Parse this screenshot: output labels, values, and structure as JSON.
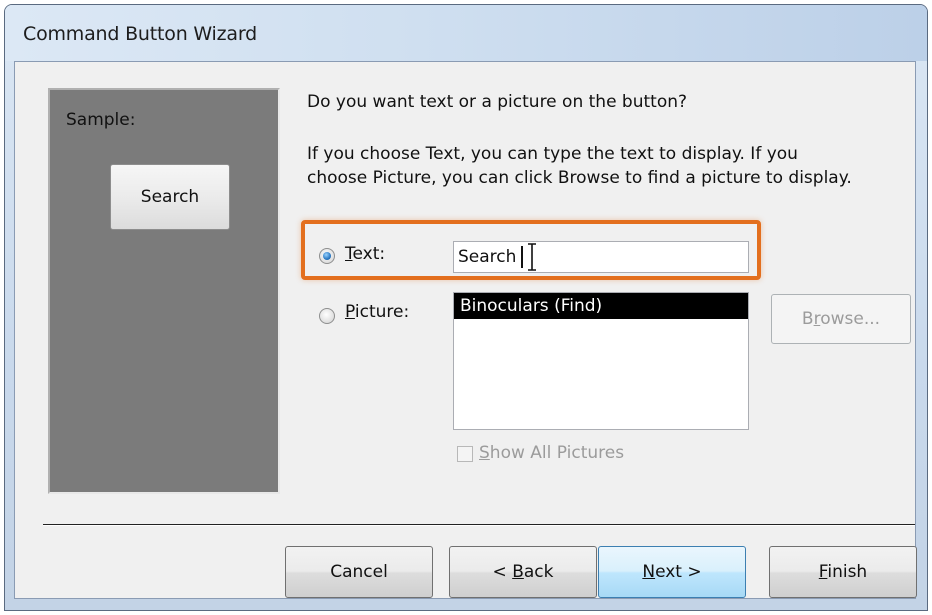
{
  "window": {
    "title": "Command Button Wizard"
  },
  "sample": {
    "label": "Sample:",
    "button_label": "Search"
  },
  "prompt": {
    "question": "Do you want text or a picture on the button?",
    "help_line1": "If you choose Text, you can type the text to display.  If you",
    "help_line2": "choose Picture, you can click Browse to find a picture to display."
  },
  "options": {
    "text_label": "Text:",
    "text_value": "Search",
    "text_selected": true,
    "picture_label": "Picture:",
    "picture_selected": false
  },
  "picture_list": {
    "items": [
      "Binoculars (Find)"
    ],
    "selected_index": 0
  },
  "browse_button": {
    "label": "Browse...",
    "enabled": false
  },
  "show_all_pictures": {
    "label": "Show All Pictures",
    "checked": false,
    "enabled": false
  },
  "footer": {
    "cancel": "Cancel",
    "back": "< Back",
    "next": "Next >",
    "finish": "Finish"
  },
  "colors": {
    "highlight": "#e36f1e",
    "sample_bg": "#7b7b7b",
    "selection": "#000000"
  }
}
